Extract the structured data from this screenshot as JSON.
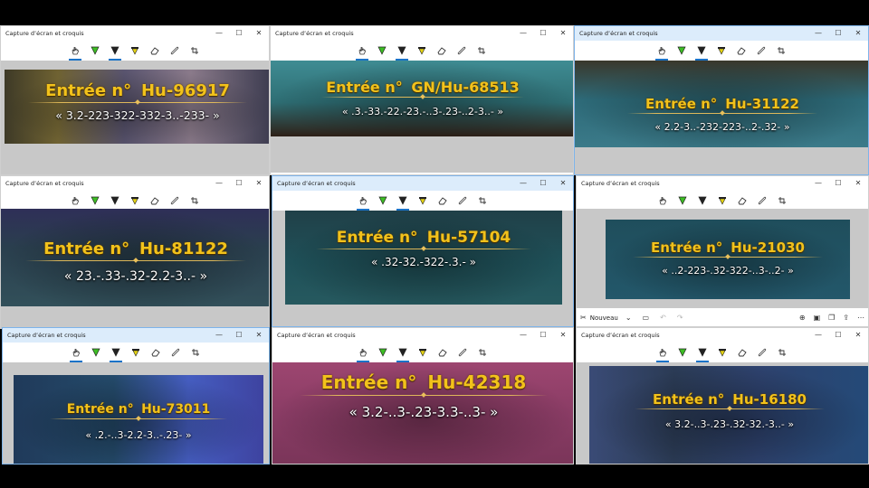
{
  "app": {
    "title": "Capture d’écran et croquis",
    "new_label": "Nouveau",
    "controls": {
      "minimize": "—",
      "maximize": "☐",
      "close": "✕"
    }
  },
  "tools": [
    {
      "name": "touch-writing-icon",
      "glyph": "hand"
    },
    {
      "name": "ballpoint-pen-icon",
      "glyph": "pen",
      "color": "#3dbd24"
    },
    {
      "name": "pencil-icon",
      "glyph": "pen",
      "color": "#222222"
    },
    {
      "name": "highlighter-icon",
      "glyph": "hl",
      "color": "#e5d312"
    },
    {
      "name": "eraser-icon",
      "glyph": "eraser"
    },
    {
      "name": "ruler-icon",
      "glyph": "ruler"
    },
    {
      "name": "crop-icon",
      "glyph": "crop"
    }
  ],
  "colors": {
    "accent": "#1a73c8",
    "gold_text": "#f2c21b",
    "active_border": "#7eb4ea"
  },
  "windows": [
    {
      "label": "Entrée n°",
      "code": "Hu-96917",
      "sequence": "« 3.2-223-322-332-3..-233- »",
      "active": false
    },
    {
      "label": "Entrée n°",
      "code": "GN/Hu-68513",
      "sequence": "« .3.-33.-22.-23.-..3-.23-..2-3..- »",
      "active": false
    },
    {
      "label": "Entrée n°",
      "code": "Hu-31122",
      "sequence": "« 2.2-3..-232-223-..2-.32- »",
      "active": true
    },
    {
      "label": "Entrée n°",
      "code": "Hu-81122",
      "sequence": "« 23.-.33-.32-2.2-3..- »",
      "active": false
    },
    {
      "label": "Entrée n°",
      "code": "Hu-57104",
      "sequence": "« .32-32.-322-.3.- »",
      "active": true
    },
    {
      "label": "Entrée n°",
      "code": "Hu-21030",
      "sequence": "« ..2-223-.32-322-..3-..2- »",
      "active": false
    },
    {
      "label": "Entrée n°",
      "code": "Hu-73011",
      "sequence": "« .2.-..3-2.2-3..-.23- »",
      "active": true
    },
    {
      "label": "Entrée n°",
      "code": "Hu-42318",
      "sequence": "« 3.2-..3-.23-3.3-..3- »",
      "active": false
    },
    {
      "label": "Entrée n°",
      "code": "Hu-16180",
      "sequence": "« 3.2-..3-.23-.32-32.-3..- »",
      "active": false
    }
  ]
}
